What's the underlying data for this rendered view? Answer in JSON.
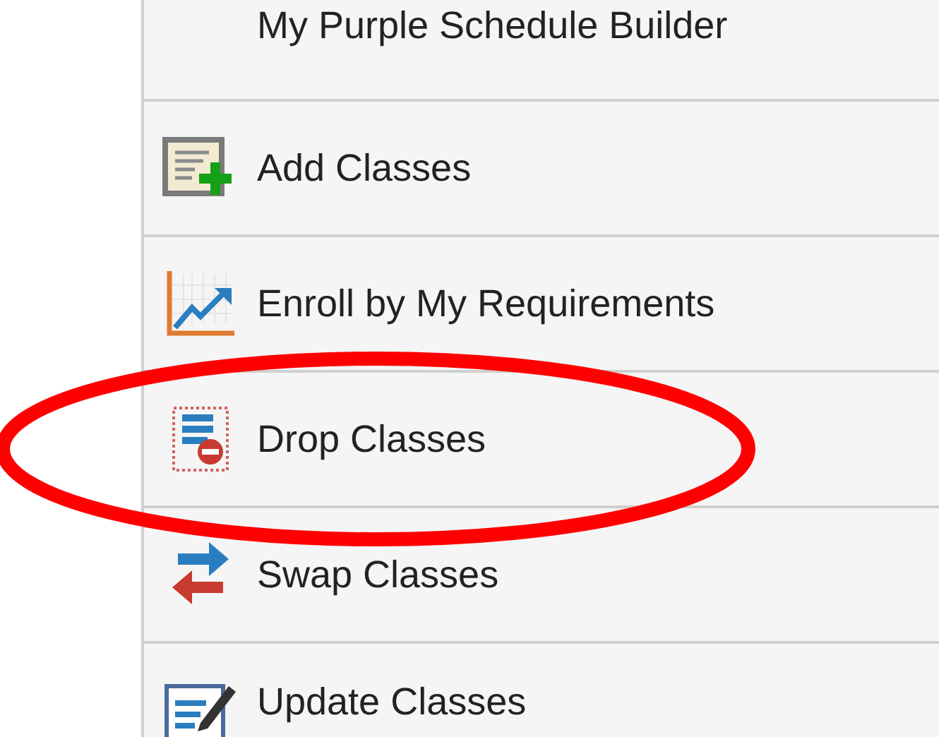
{
  "menu": {
    "items": [
      {
        "label": "My Purple Schedule Builder",
        "kind": "none",
        "circled": false
      },
      {
        "label": "Add Classes",
        "kind": "add",
        "circled": false
      },
      {
        "label": "Enroll by My Requirements",
        "kind": "chart",
        "circled": false
      },
      {
        "label": "Drop Classes",
        "kind": "drop",
        "circled": true
      },
      {
        "label": "Swap Classes",
        "kind": "swap",
        "circled": false
      },
      {
        "label": "Update Classes",
        "kind": "update",
        "circled": false
      }
    ]
  }
}
